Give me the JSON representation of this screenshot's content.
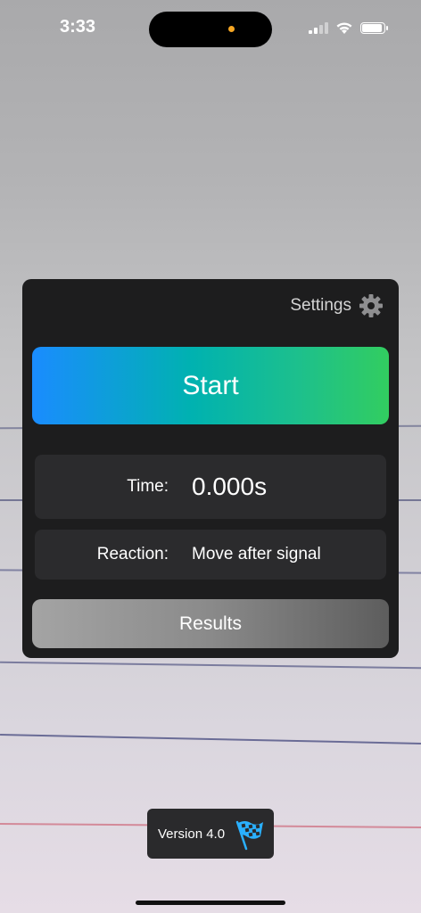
{
  "status_bar": {
    "time": "3:33",
    "icons": [
      "signal-icon",
      "wifi-icon",
      "battery-icon"
    ]
  },
  "panel": {
    "settings_label": "Settings",
    "start_label": "Start",
    "time_label": "Time:",
    "time_value": "0.000s",
    "reaction_label": "Reaction:",
    "reaction_value": "Move after signal",
    "results_label": "Results"
  },
  "footer": {
    "version_label": "Version 4.0"
  },
  "colors": {
    "accent_start": "#1a8cff",
    "accent_end": "#32cd60",
    "panel_bg": "#1d1d1e",
    "row_bg": "#2b2b2d"
  }
}
